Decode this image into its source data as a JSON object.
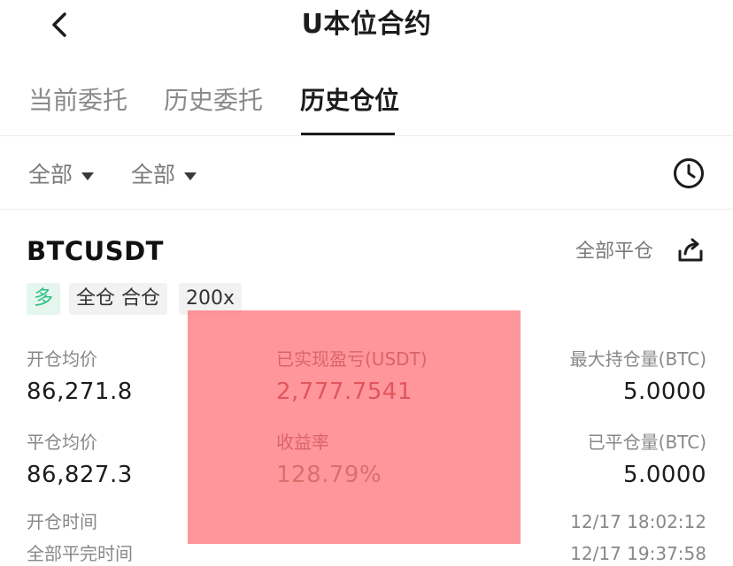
{
  "header": {
    "title": "U本位合约"
  },
  "tabs": [
    {
      "label": "当前委托",
      "active": false
    },
    {
      "label": "历史委托",
      "active": false
    },
    {
      "label": "历史仓位",
      "active": true
    }
  ],
  "filters": [
    {
      "label": "全部"
    },
    {
      "label": "全部"
    }
  ],
  "position": {
    "symbol": "BTCUSDT",
    "close_all_label": "全部平仓",
    "tags": {
      "side": "多",
      "margin_mode": "全仓 合仓",
      "leverage": "200x"
    },
    "open_avg_price_label": "开仓均价",
    "open_avg_price": "86,271.8",
    "realized_pnl_label": "已实现盈亏(USDT)",
    "realized_pnl": "2,777.7541",
    "max_position_label": "最大持仓量(BTC)",
    "max_position": "5.0000",
    "close_avg_price_label": "平仓均价",
    "close_avg_price": "86,827.3",
    "roi_label": "收益率",
    "roi": "128.79%",
    "closed_qty_label": "已平仓量(BTC)",
    "closed_qty": "5.0000",
    "open_time_label": "开仓时间",
    "open_time": "12/17 18:02:12",
    "full_close_time_label": "全部平完时间",
    "full_close_time": "12/17 19:37:58"
  },
  "colors": {
    "long_green": "#2ebd85",
    "overlay_red": "#ff6e76",
    "text_primary": "#1c1c1c",
    "text_secondary": "#888888"
  },
  "icons": {
    "back": "chevron-left-icon",
    "filter_caret": "caret-down-icon",
    "history": "clock-icon",
    "share": "share-icon"
  }
}
